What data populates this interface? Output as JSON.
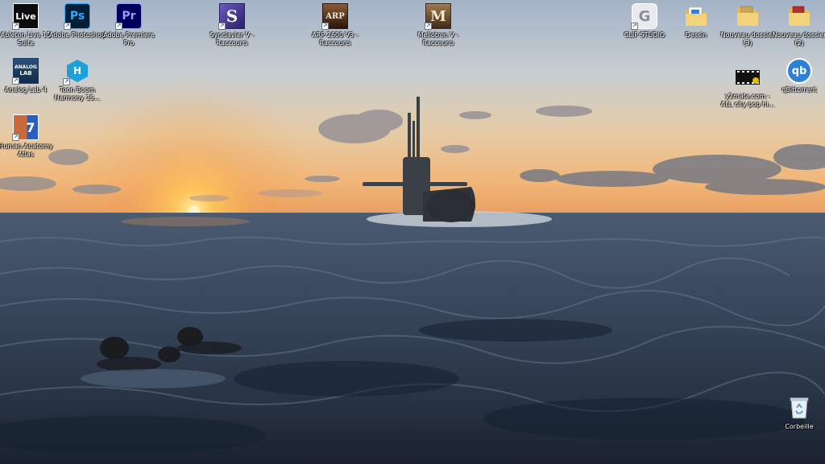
{
  "desktop": {
    "icons": [
      {
        "label": "Ableton Live 11 Suite",
        "glyph": "Live",
        "icon": "ableton-live-icon",
        "bg": "#0d0d0d",
        "fg": "#ffffff",
        "border": "#ffffff",
        "shortcut": true
      },
      {
        "label": "Adobe Photoshop",
        "glyph": "Ps",
        "icon": "photoshop-icon",
        "bg": "#001e36",
        "fg": "#31a8ff",
        "border": "#31a8ff",
        "shortcut": true
      },
      {
        "label": "Adobe Premiere Pro",
        "glyph": "Pr",
        "icon": "premiere-pro-icon",
        "bg": "#00005b",
        "fg": "#9999ff",
        "border": "#9999ff",
        "shortcut": true
      },
      {
        "label": "Synclavier V - Raccourci",
        "glyph": "S",
        "icon": "synclavier-icon",
        "bg": "#4a3a9a",
        "fg": "#ffffff",
        "border": "#2a1f66",
        "shortcut": true
      },
      {
        "label": "ARP 2600 V3 - Raccourci",
        "glyph": "ARP",
        "icon": "arp-2600-icon",
        "bg": "#4b2a17",
        "fg": "#f2e2cf",
        "border": "#2b160b",
        "shortcut": true
      },
      {
        "label": "Mellotron V - Raccourci",
        "glyph": "M",
        "icon": "mellotron-icon",
        "bg": "#7a5a3a",
        "fg": "#f4e6c8",
        "border": "#3d2a18",
        "shortcut": true
      },
      {
        "label": "CLIP STUDIO",
        "glyph": "G",
        "icon": "clip-studio-icon",
        "bg": "#e8eaee",
        "fg": "#8a8f99",
        "border": "#ffffff",
        "shortcut": true
      },
      {
        "label": "Dessin",
        "glyph": "",
        "icon": "folder-icon",
        "bg": "#f3d27a",
        "fg": "#3a7bd5",
        "border": "#d9aa3c",
        "shortcut": false
      },
      {
        "label": "Nouveau dossier (3)",
        "glyph": "",
        "icon": "folder-icon",
        "bg": "#f3d27a",
        "fg": "#c9a55a",
        "border": "#d9aa3c",
        "shortcut": false
      },
      {
        "label": "Nouveau dossier (2)",
        "glyph": "",
        "icon": "folder-icon",
        "bg": "#f3d27a",
        "fg": "#b03030",
        "border": "#d9aa3c",
        "shortcut": false
      },
      {
        "label": "Analog Lab 4",
        "glyph": "LAB",
        "icon": "analog-lab-icon",
        "bg": "#0f2a4a",
        "fg": "#ffffff",
        "border": "#1c3d66",
        "shortcut": true
      },
      {
        "label": "Toon Boom Harmony 15...",
        "glyph": "H",
        "icon": "toon-boom-harmony-icon",
        "bg": "#1fa0d8",
        "fg": "#ffffff",
        "border": "#1fa0d8",
        "shortcut": true
      },
      {
        "label": "y2mate.com - ALL city pop hi...",
        "glyph": "",
        "icon": "video-file-icon",
        "bg": "#111111",
        "fg": "#e6b800",
        "border": "#000000",
        "shortcut": false
      },
      {
        "label": "qBittorrent",
        "glyph": "qb",
        "icon": "qbittorrent-icon",
        "bg": "#2e7fd6",
        "fg": "#ffffff",
        "border": "#ffffff",
        "shortcut": false
      },
      {
        "label": "Human Anatomy Atlas",
        "glyph": "7",
        "icon": "human-anatomy-atlas-icon",
        "bg": "#c96a3a",
        "fg": "#2b5fbf",
        "border": "#ffffff",
        "shortcut": true
      },
      {
        "label": "Corbeille",
        "glyph": "",
        "icon": "recycle-bin-icon",
        "bg": "transparent",
        "fg": "#3a8fd6",
        "border": "transparent",
        "shortcut": false
      }
    ]
  }
}
